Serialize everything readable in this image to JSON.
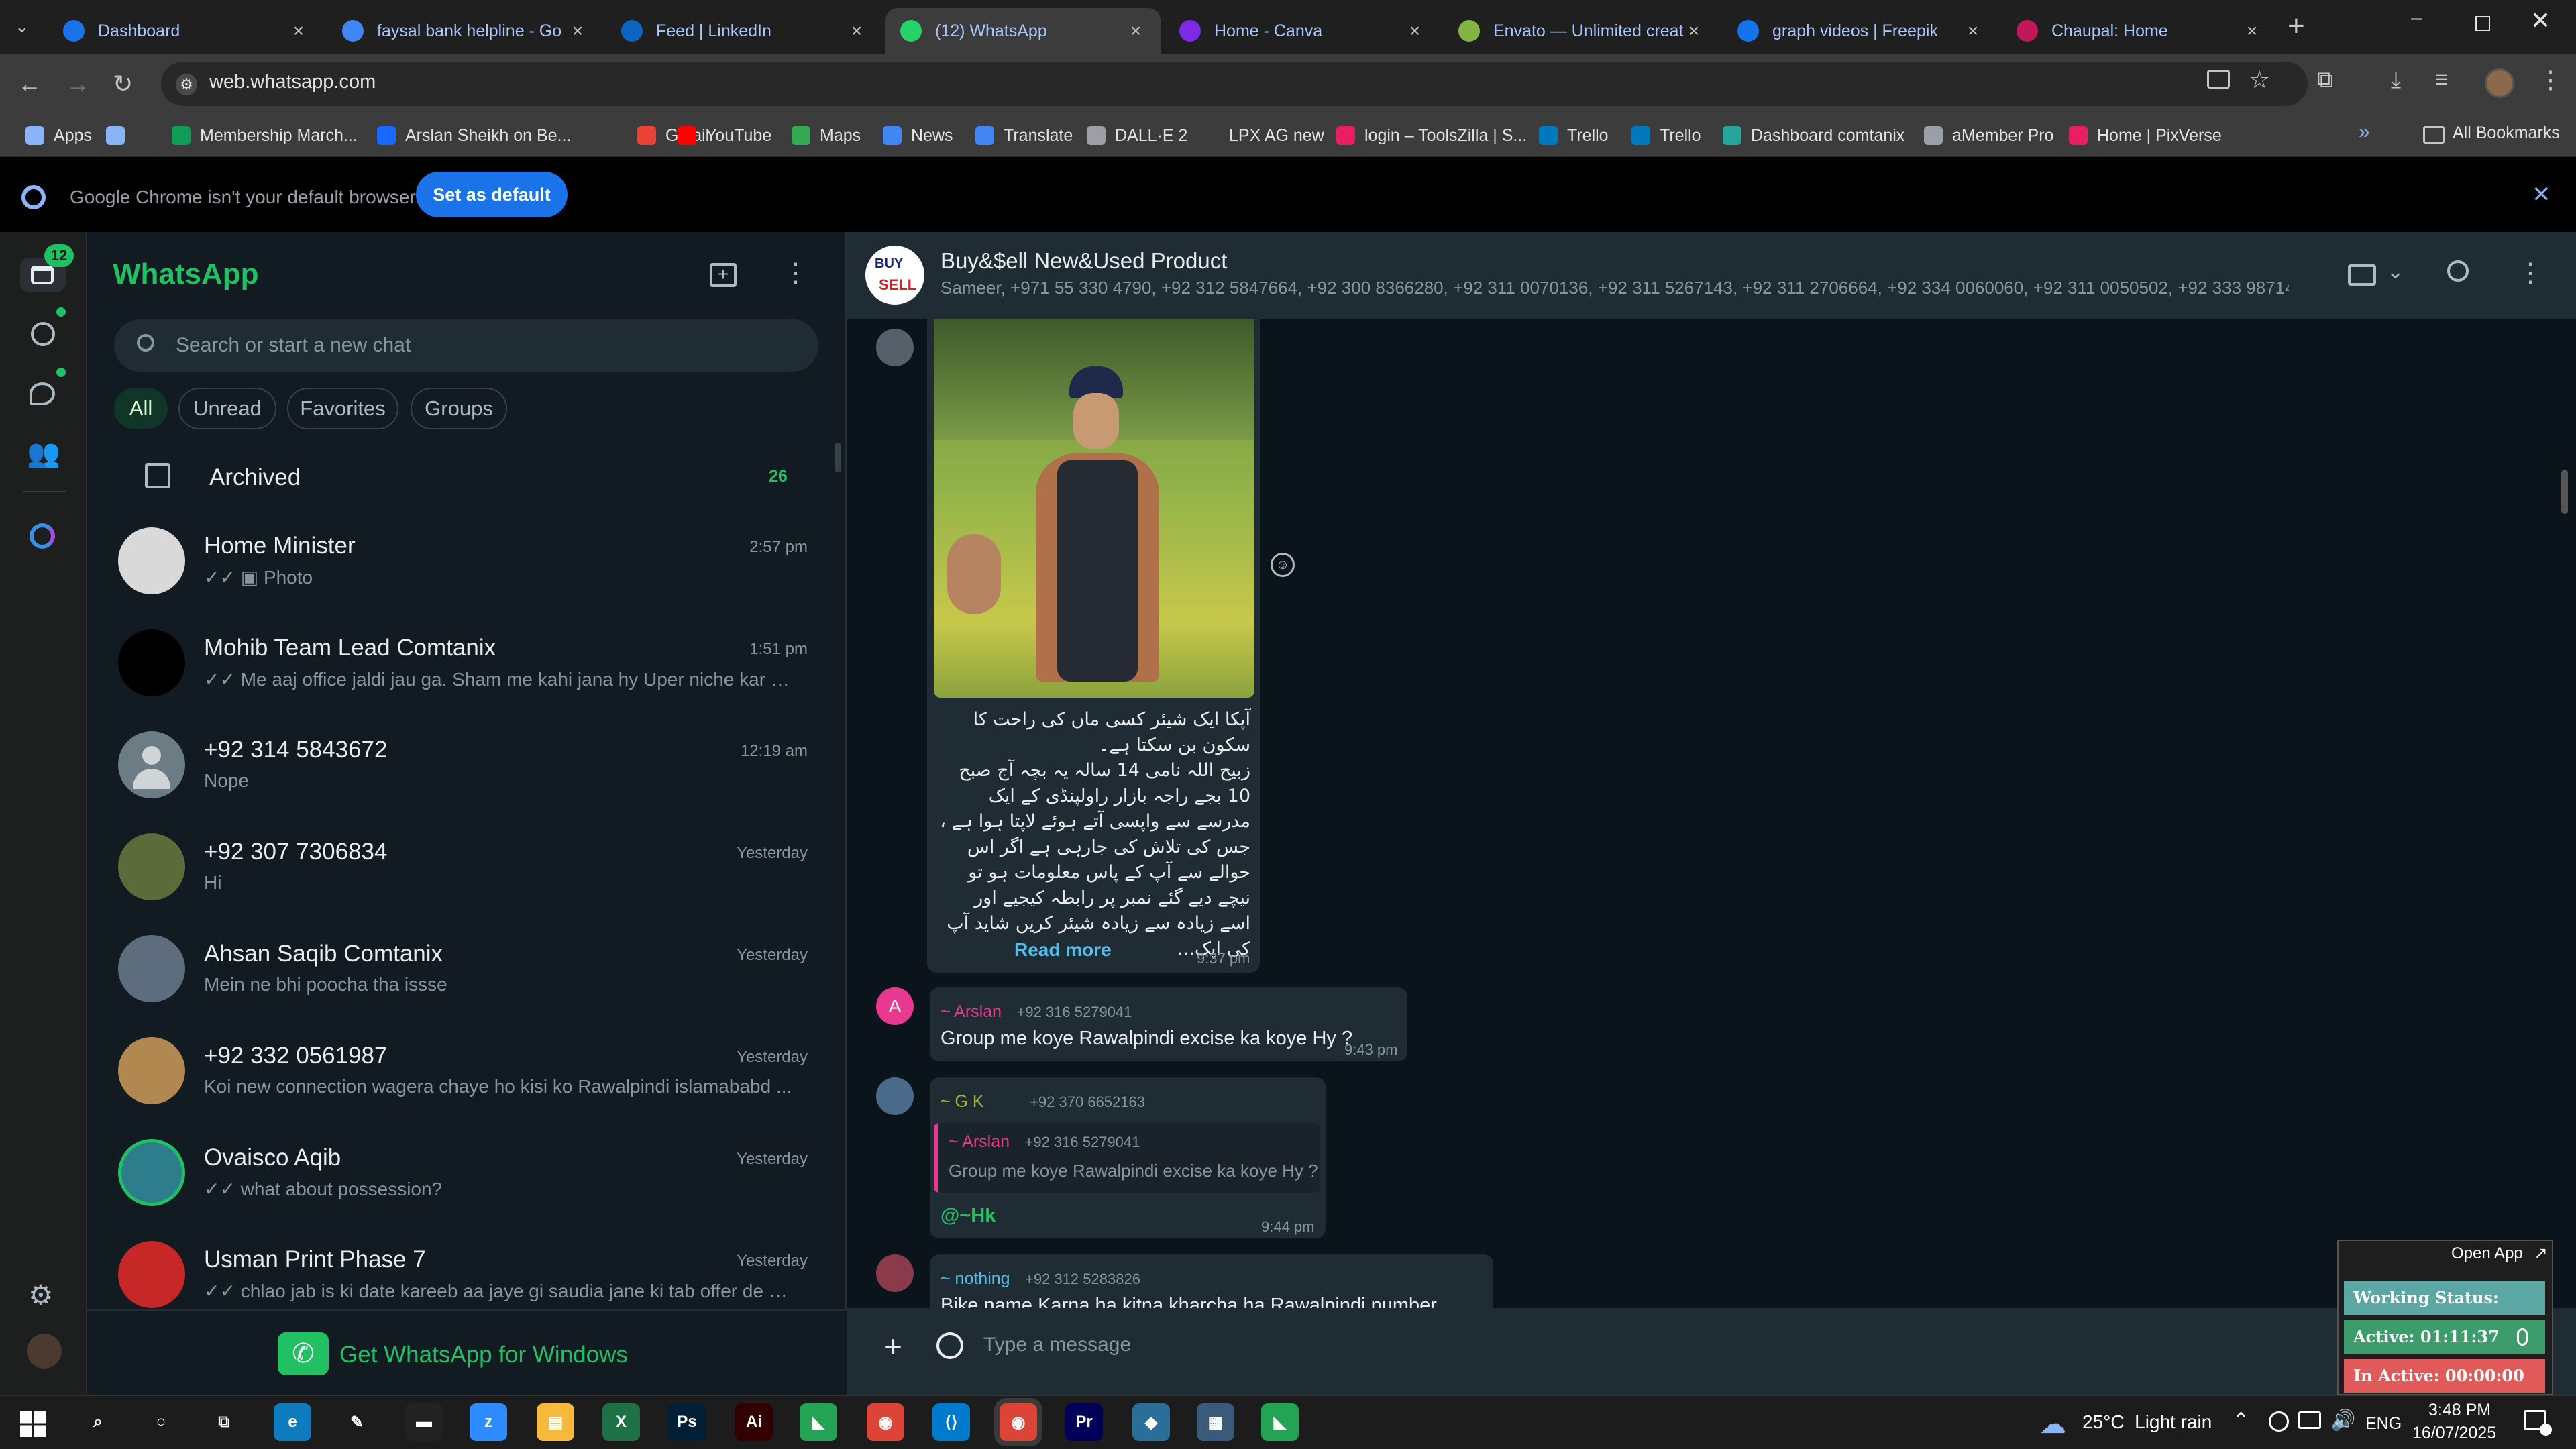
{
  "browser": {
    "tabs": [
      {
        "label": "Dashboard",
        "icon": "dashboard-favicon",
        "color": "#1a73e8",
        "active": false
      },
      {
        "label": "faysal bank helpline - Go",
        "icon": "google-favicon",
        "color": "#4285f4",
        "active": false
      },
      {
        "label": "Feed | LinkedIn",
        "icon": "linkedin-favicon",
        "color": "#0a66c2",
        "active": false
      },
      {
        "label": "(12) WhatsApp",
        "icon": "whatsapp-favicon",
        "color": "#25d366",
        "active": true
      },
      {
        "label": "Home - Canva",
        "icon": "canva-favicon",
        "color": "#7d2ae8",
        "active": false
      },
      {
        "label": "Envato — Unlimited creat",
        "icon": "envato-favicon",
        "color": "#82b541",
        "active": false
      },
      {
        "label": "graph videos | Freepik",
        "icon": "freepik-favicon",
        "color": "#1273eb",
        "active": false
      },
      {
        "label": "Chaupal: Home",
        "icon": "chaupal-favicon",
        "color": "#c2185b",
        "active": false
      }
    ],
    "url": "web.whatsapp.com",
    "bookmarks": [
      {
        "label": "Apps",
        "color": "#8ab4f8"
      },
      {
        "label": "",
        "color": "#8ab4f8"
      },
      {
        "label": "Membership March...",
        "color": "#0f9d58"
      },
      {
        "label": "Arslan Sheikh on Be...",
        "color": "#1769ff"
      },
      {
        "label": "Gmail",
        "color": "#ea4335"
      },
      {
        "label": "YouTube",
        "color": "#ff0000"
      },
      {
        "label": "Maps",
        "color": "#34a853"
      },
      {
        "label": "News",
        "color": "#4285f4"
      },
      {
        "label": "Translate",
        "color": "#4285f4"
      },
      {
        "label": "DALL·E 2",
        "color": "#9aa0a6"
      },
      {
        "label": "LPX AG new",
        "color": "#3c3c3c"
      },
      {
        "label": "login – ToolsZilla | S...",
        "color": "#e91e63"
      },
      {
        "label": "Trello",
        "color": "#0079bf"
      },
      {
        "label": "Trello",
        "color": "#0079bf"
      },
      {
        "label": "Dashboard comtanix",
        "color": "#26a69a"
      },
      {
        "label": "aMember Pro",
        "color": "#9aa0a6"
      },
      {
        "label": "Home | PixVerse",
        "color": "#e91e63"
      }
    ],
    "all_bookmarks": "All Bookmarks",
    "infobar_text": "Google Chrome isn't your default browser",
    "infobar_button": "Set as default"
  },
  "whatsapp": {
    "title": "WhatsApp",
    "unread_badge": "12",
    "search_placeholder": "Search or start a new chat",
    "filters": [
      "All",
      "Unread",
      "Favorites",
      "Groups"
    ],
    "archived_label": "Archived",
    "archived_count": "26",
    "chats": [
      {
        "name": "Home Minister",
        "time": "2:57 pm",
        "preview": "Photo",
        "ticks": true,
        "photo": true,
        "avatar_color": "#d9d9d9"
      },
      {
        "name": "Mohib Team Lead Comtanix",
        "time": "1:51 pm",
        "preview": "Me aaj office jaldi jau ga.  Sham me kahi jana hy  Uper niche kar k...",
        "ticks": true,
        "photo": false,
        "avatar_color": "#000000"
      },
      {
        "name": "+92 314 5843672",
        "time": "12:19 am",
        "preview": "Nope",
        "ticks": false,
        "photo": false,
        "avatar_color": "#6b7c85"
      },
      {
        "name": "+92 307 7306834",
        "time": "Yesterday",
        "preview": "Hi",
        "ticks": false,
        "photo": false,
        "avatar_color": "#5c6b3a"
      },
      {
        "name": "Ahsan Saqib Comtanix",
        "time": "Yesterday",
        "preview": "Mein ne bhi poocha tha issse",
        "ticks": false,
        "photo": false,
        "avatar_color": "#5d6d7e"
      },
      {
        "name": "+92 332 0561987",
        "time": "Yesterday",
        "preview": "Koi new connection wagera chaye ho kisi ko Rawalpindi islamababd ...",
        "ticks": false,
        "photo": false,
        "avatar_color": "#b08850"
      },
      {
        "name": "Ovaisco Aqib",
        "time": "Yesterday",
        "preview": "what about possession?",
        "ticks": true,
        "photo": false,
        "avatar_color": "#2e7d8c"
      },
      {
        "name": "Usman Print Phase 7",
        "time": "Yesterday",
        "preview": "chlao jab is ki date kareeb aa jaye gi  saudia jane ki tab offer de d...",
        "ticks": true,
        "photo": false,
        "avatar_color": "#c62828"
      }
    ],
    "get_app": "Get WhatsApp for Windows",
    "group": {
      "name": "Buy&$ell New&Used Product",
      "members": "Sameer, +971 55 330 4790, +92 312 5847664, +92 300 8366280, +92 311 0070136, +92 311 5267143, +92 311 2706664, +92 334 0060060, +92 311 0050502, +92 333 98714..."
    },
    "messages": {
      "urdu_lines": [
        "آپکا ایک شیئر کسی ماں کی راحت کا",
        "سکون بن سکتا ہے۔",
        "زبیح اللہ نامی 14 سالہ یہ بچہ آج صبح",
        "10 بجے راجہ بازار راولپنڈی کے ایک",
        "مدرسے سے واپسی آتے ہوئے لاپتا ہوا ہے ،",
        "جس کی تلاش کی جارہی ہے اگر اس",
        "حوالے سے آپ کے پاس معلومات ہو تو",
        "نیچے دیے گئے نمبر پر رابطہ کیجیے اور",
        "اسے زیادہ سے زیادہ شیئر کریں شاید آپ",
        "کی ایک..."
      ],
      "read_more": "Read more",
      "image_time": "9:37 pm",
      "m1_avatar": "A",
      "m1_sender": "~ Arslan",
      "m1_phone": "+92 316 5279041",
      "m1_text": "Group me koye Rawalpindi excise ka koye Hy ?",
      "m1_time": "9:43 pm",
      "m2_sender": "~ G K",
      "m2_phone": "+92 370 6652163",
      "m2_quote_sender": "~ Arslan",
      "m2_quote_phone": "+92 316 5279041",
      "m2_quote_text": "Group me koye Rawalpindi excise ka koye Hy ?",
      "m2_text": "@~Hk",
      "m2_time": "9:44 pm",
      "m3_sender": "~ nothing",
      "m3_phone": "+92 312 5283826",
      "m3_text": "Bike name Karna ha kitna kharcha ha Rawalpindi number"
    },
    "compose_placeholder": "Type a message"
  },
  "tracker": {
    "open_app": "Open App",
    "working_status": "Working Status: Active",
    "active": "Active: 01:11:37",
    "inactive": "In Active: 00:00:00"
  },
  "taskbar": {
    "weather": "25°C  Light rain",
    "lang": "ENG",
    "time": "3:48 PM",
    "date": "16/07/2025"
  }
}
